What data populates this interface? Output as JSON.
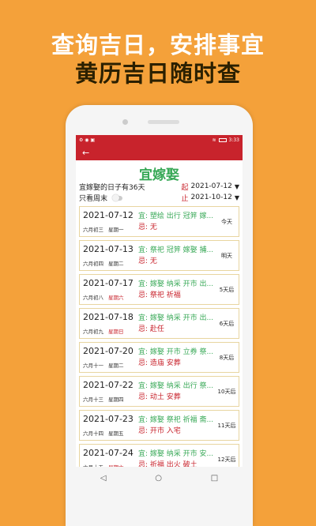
{
  "promo": {
    "line1": "查询吉日，安排事宜",
    "line2": "黄历吉日随时查"
  },
  "status": {
    "time": "3:33"
  },
  "appbar": {
    "back": "←"
  },
  "page": {
    "title": "宜嫁娶"
  },
  "filters": {
    "count_text": "宜嫁娶的日子有36天",
    "weekend_label": "只看周末",
    "start_label": "起",
    "start_date": "2021-07-12",
    "end_label": "止",
    "end_date": "2021-10-12",
    "dropdown": "▼"
  },
  "days": [
    {
      "date": "2021-07-12",
      "lunar": "六月初三",
      "week": "星期一",
      "weekend": false,
      "yi": "宜: 塑绘 出行 冠笄 嫁...",
      "ji": "忌: 无",
      "rel": "今天"
    },
    {
      "date": "2021-07-13",
      "lunar": "六月初四",
      "week": "星期二",
      "weekend": false,
      "yi": "宜: 祭祀 冠笄 嫁娶 捕...",
      "ji": "忌: 无",
      "rel": "明天"
    },
    {
      "date": "2021-07-17",
      "lunar": "六月初八",
      "week": "星期六",
      "weekend": true,
      "yi": "宜: 嫁娶 纳采 开市 出...",
      "ji": "忌: 祭祀 祈福",
      "rel": "5天后"
    },
    {
      "date": "2021-07-18",
      "lunar": "六月初九",
      "week": "星期日",
      "weekend": true,
      "yi": "宜: 嫁娶 纳采 开市 出...",
      "ji": "忌: 赴任",
      "rel": "6天后"
    },
    {
      "date": "2021-07-20",
      "lunar": "六月十一",
      "week": "星期二",
      "weekend": false,
      "yi": "宜: 嫁娶 开市 立券 祭...",
      "ji": "忌: 造庙 安葬",
      "rel": "8天后"
    },
    {
      "date": "2021-07-22",
      "lunar": "六月十三",
      "week": "星期四",
      "weekend": false,
      "yi": "宜: 嫁娶 纳采 出行 祭...",
      "ji": "忌: 动土 安葬",
      "rel": "10天后"
    },
    {
      "date": "2021-07-23",
      "lunar": "六月十四",
      "week": "星期五",
      "weekend": false,
      "yi": "宜: 嫁娶 祭祀 祈福 斋...",
      "ji": "忌: 开市 入宅",
      "rel": "11天后"
    },
    {
      "date": "2021-07-24",
      "lunar": "六月十五",
      "week": "星期六",
      "weekend": true,
      "yi": "宜: 嫁娶 纳采 开市 安...",
      "ji": "忌: 祈福 出火 破土",
      "rel": "12天后"
    }
  ],
  "nav": {
    "back": "◁",
    "home": "○",
    "recent": "□"
  },
  "colors": {
    "background": "#F4A13A",
    "accent": "#C8232C",
    "green": "#37A856"
  }
}
